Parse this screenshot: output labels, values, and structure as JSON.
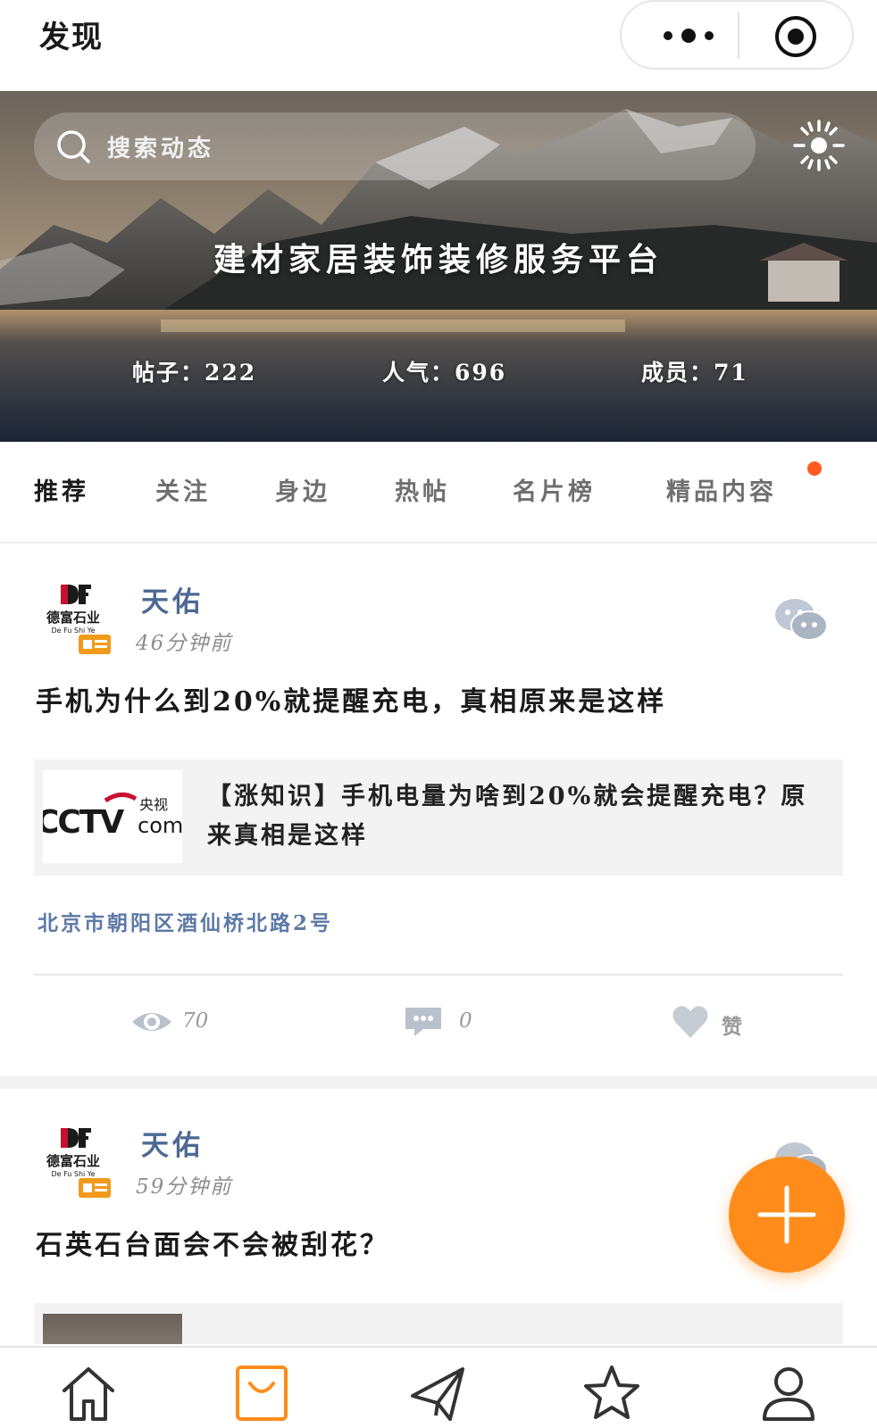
{
  "header": {
    "title": "发现",
    "more_icon": "more-dots-icon",
    "close_icon": "target-close-icon"
  },
  "banner": {
    "search_placeholder": "搜索动态",
    "title": "建材家居装饰装修服务平台",
    "stats": {
      "posts": "帖子：222",
      "popularity": "人气：696",
      "members": "成员：71"
    }
  },
  "tabs": [
    "推荐",
    "关注",
    "身边",
    "热帖",
    "名片榜",
    "精品内容"
  ],
  "posts": [
    {
      "author": "天佑",
      "time": "46分钟前",
      "title": "手机为什么到20%就提醒充电，真相原来是这样",
      "link_title": "【涨知识】手机电量为啥到20%就会提醒充电？原来真相是这样",
      "thumb_text_main": "CCTV",
      "thumb_text_cn": "央视",
      "thumb_text_com": "com",
      "location": "北京市朝阳区酒仙桥北路2号",
      "views": "70",
      "comments": "0",
      "like_label": "赞"
    },
    {
      "author": "天佑",
      "time": "59分钟前",
      "title": "石英石台面会不会被刮花？"
    }
  ],
  "avatar_text": {
    "cn": "德富石业",
    "en": "De Fu Shi Ye"
  },
  "colors": {
    "accent": "#ff8c1a",
    "author": "#4c6a93",
    "badge_dot": "#ff5a1f"
  }
}
